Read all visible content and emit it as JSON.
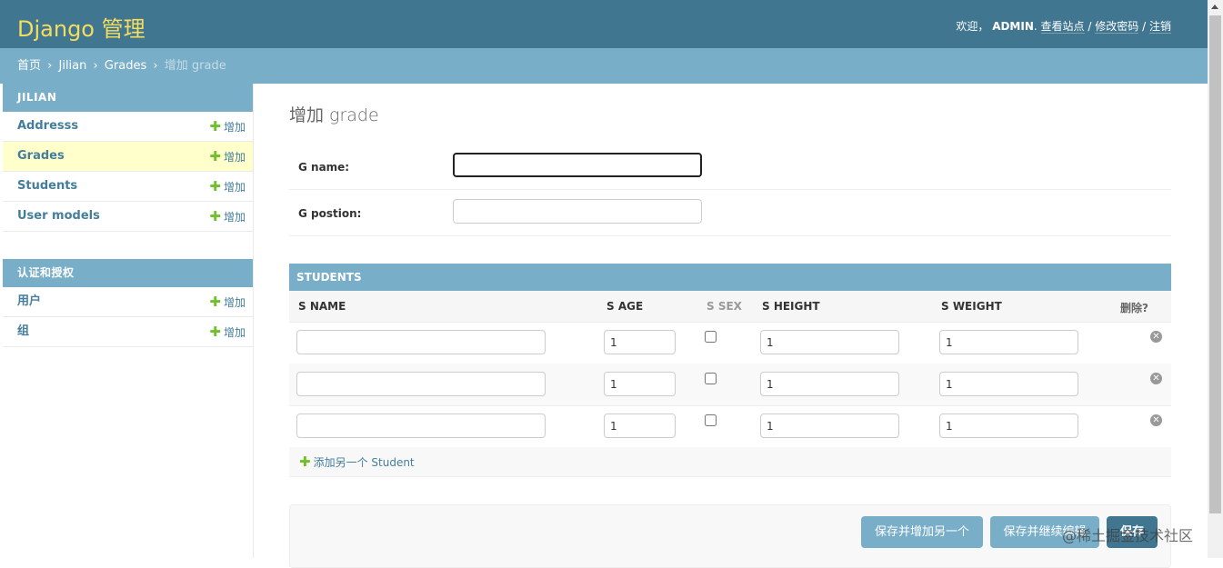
{
  "header": {
    "brand": "Django 管理",
    "welcome": "欢迎，",
    "username": "ADMIN",
    "username_suffix": ".",
    "view_site": "查看站点",
    "sep": "/",
    "change_password": "修改密码",
    "logout": "注销"
  },
  "breadcrumbs": {
    "home": "首页",
    "app": "Jilian",
    "model": "Grades",
    "current": "增加 grade",
    "separator": "›"
  },
  "sidebar": {
    "modules": [
      {
        "caption": "JILIAN",
        "items": [
          {
            "label": "Addresss",
            "add": "增加"
          },
          {
            "label": "Grades",
            "add": "增加"
          },
          {
            "label": "Students",
            "add": "增加"
          },
          {
            "label": "User models",
            "add": "增加"
          }
        ]
      },
      {
        "caption": "认证和授权",
        "items": [
          {
            "label": "用户",
            "add": "增加"
          },
          {
            "label": "组",
            "add": "增加"
          }
        ]
      }
    ]
  },
  "page": {
    "title": "增加 grade",
    "fields": [
      {
        "label": "G name:",
        "value": ""
      },
      {
        "label": "G postion:",
        "value": ""
      }
    ]
  },
  "inline": {
    "caption": "STUDENTS",
    "headers": {
      "s_name": "S NAME",
      "s_age": "S AGE",
      "s_sex": "S SEX",
      "s_height": "S HEIGHT",
      "s_weight": "S WEIGHT",
      "delete": "删除?"
    },
    "rows": [
      {
        "s_name": "",
        "s_age": "1",
        "s_sex": false,
        "s_height": "1",
        "s_weight": "1"
      },
      {
        "s_name": "",
        "s_age": "1",
        "s_sex": false,
        "s_height": "1",
        "s_weight": "1"
      },
      {
        "s_name": "",
        "s_age": "1",
        "s_sex": false,
        "s_height": "1",
        "s_weight": "1"
      }
    ],
    "add_another": "添加另一个 Student"
  },
  "submit": {
    "save_add_another": "保存并增加另一个",
    "save_continue": "保存并继续编辑",
    "save": "保存"
  },
  "watermark": "@稀土掘金技术社区",
  "colors": {
    "header_bg": "#417690",
    "brand": "#f5dd5d",
    "breadcrumb_bg": "#79aec8",
    "caption_bg": "#79aec8",
    "active_row": "#ffffcc",
    "add_plus": "#70bf2b",
    "link": "#447e9b"
  }
}
